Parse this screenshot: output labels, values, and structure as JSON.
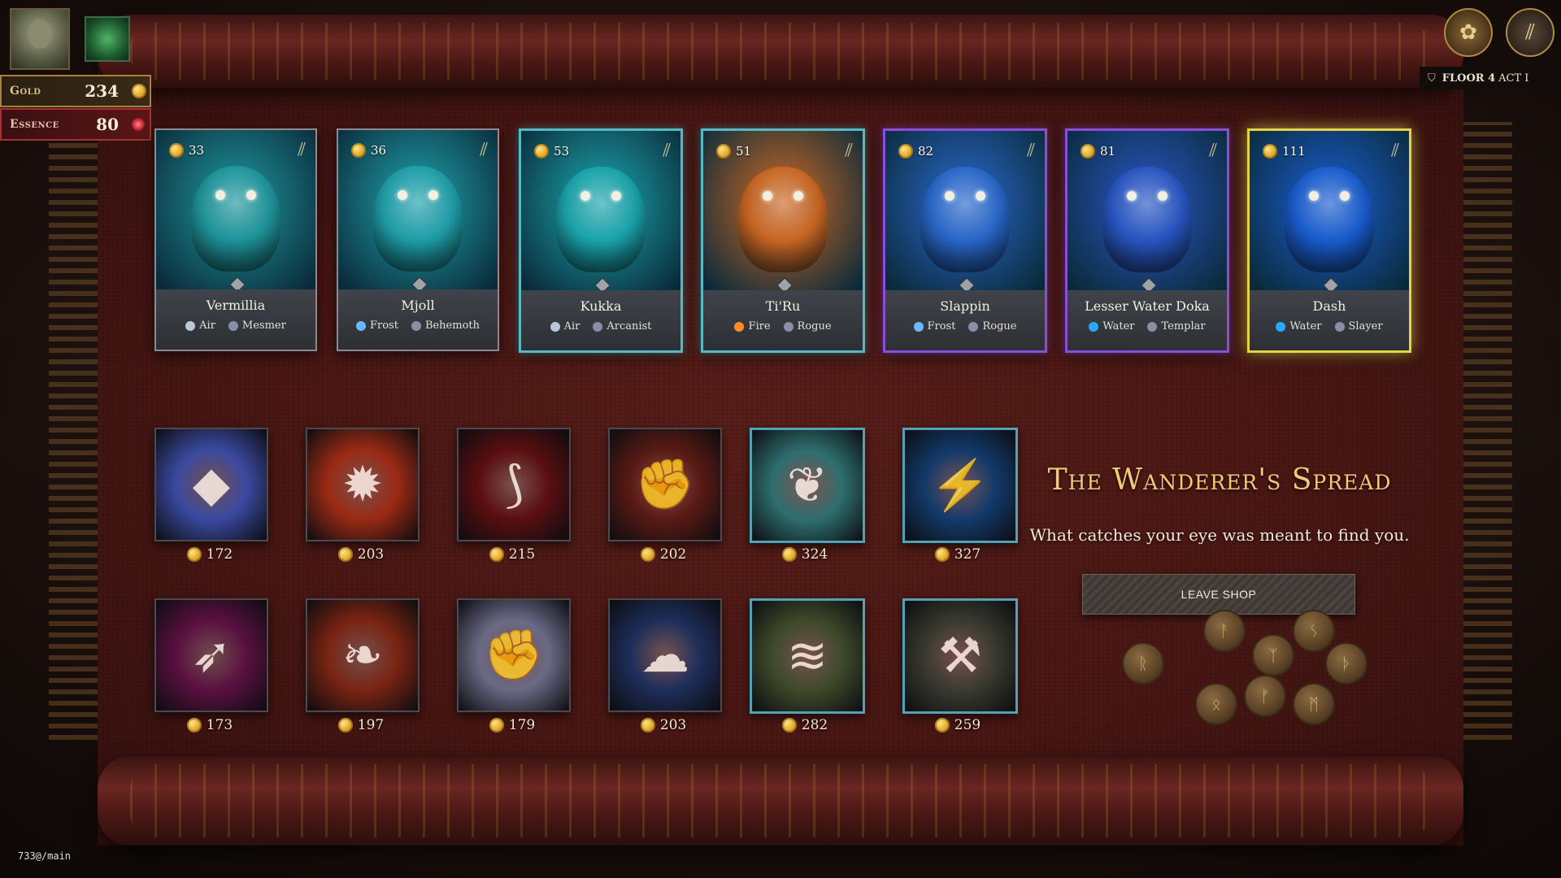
{
  "hud": {
    "gold_label": "Gold",
    "gold_value": "234",
    "essence_label": "Essence",
    "essence_value": "80",
    "floor_label": "FLOOR 4",
    "act_label": "ACT I",
    "icons": [
      "character-portrait",
      "relic-icon",
      "gold-coin-icon",
      "essence-icon",
      "map-button-icon",
      "menu-button-icon"
    ]
  },
  "creatures": [
    {
      "name": "Vermillia",
      "cost": "33",
      "type": "Air",
      "class": "Mesmer",
      "rarity": "common",
      "color": "#1f9aa0"
    },
    {
      "name": "Mjoll",
      "cost": "36",
      "type": "Frost",
      "class": "Behemoth",
      "rarity": "common",
      "color": "#20a4ae"
    },
    {
      "name": "Kukka",
      "cost": "53",
      "type": "Air",
      "class": "Arcanist",
      "rarity": "rare",
      "color": "#1ba9b0"
    },
    {
      "name": "Ti'Ru",
      "cost": "51",
      "type": "Fire",
      "class": "Rogue",
      "rarity": "rare",
      "color": "#d06a24"
    },
    {
      "name": "Slappin",
      "cost": "82",
      "type": "Frost",
      "class": "Rogue",
      "rarity": "epic",
      "color": "#2a6ad0"
    },
    {
      "name": "Lesser Water Doka",
      "cost": "81",
      "type": "Water",
      "class": "Templar",
      "rarity": "epic",
      "color": "#2a58c8"
    },
    {
      "name": "Dash",
      "cost": "111",
      "type": "Water",
      "class": "Slayer",
      "rarity": "legend",
      "color": "#1a5fd4"
    }
  ],
  "items_row1": [
    {
      "price": "172",
      "icon": "crystal-shard-icon",
      "frame": "plain",
      "color": "#3a4aa0"
    },
    {
      "price": "203",
      "icon": "molten-rock-icon",
      "frame": "plain",
      "color": "#9a2a14"
    },
    {
      "price": "215",
      "icon": "bloody-fang-icon",
      "frame": "plain",
      "color": "#5a0e10"
    },
    {
      "price": "202",
      "icon": "ember-gauntlet-icon",
      "frame": "plain",
      "color": "#5a1a14"
    },
    {
      "price": "324",
      "icon": "spirit-wisp-icon",
      "frame": "teal",
      "color": "#2e6e6e"
    },
    {
      "price": "327",
      "icon": "lightning-potion-icon",
      "frame": "teal",
      "color": "#123a6a"
    }
  ],
  "items_row2": [
    {
      "price": "173",
      "icon": "pink-spear-icon",
      "frame": "plain",
      "color": "#5a1040"
    },
    {
      "price": "197",
      "icon": "burning-wings-icon",
      "frame": "plain",
      "color": "#7a2412"
    },
    {
      "price": "179",
      "icon": "spirit-fist-icon",
      "frame": "plain",
      "color": "#6a6a86"
    },
    {
      "price": "203",
      "icon": "shadow-cloak-icon",
      "frame": "plain",
      "color": "#1e2e5a"
    },
    {
      "price": "282",
      "icon": "bark-icon",
      "frame": "teal",
      "color": "#3e4a2a"
    },
    {
      "price": "259",
      "icon": "shovel-icon",
      "frame": "teal",
      "color": "#3a3a30"
    }
  ],
  "shop": {
    "title": "The Wanderer's Spread",
    "subtitle": "What catches your eye was meant to find you.",
    "leave_label": "LEAVE SHOP"
  },
  "footer": {
    "version": "733@/main"
  }
}
